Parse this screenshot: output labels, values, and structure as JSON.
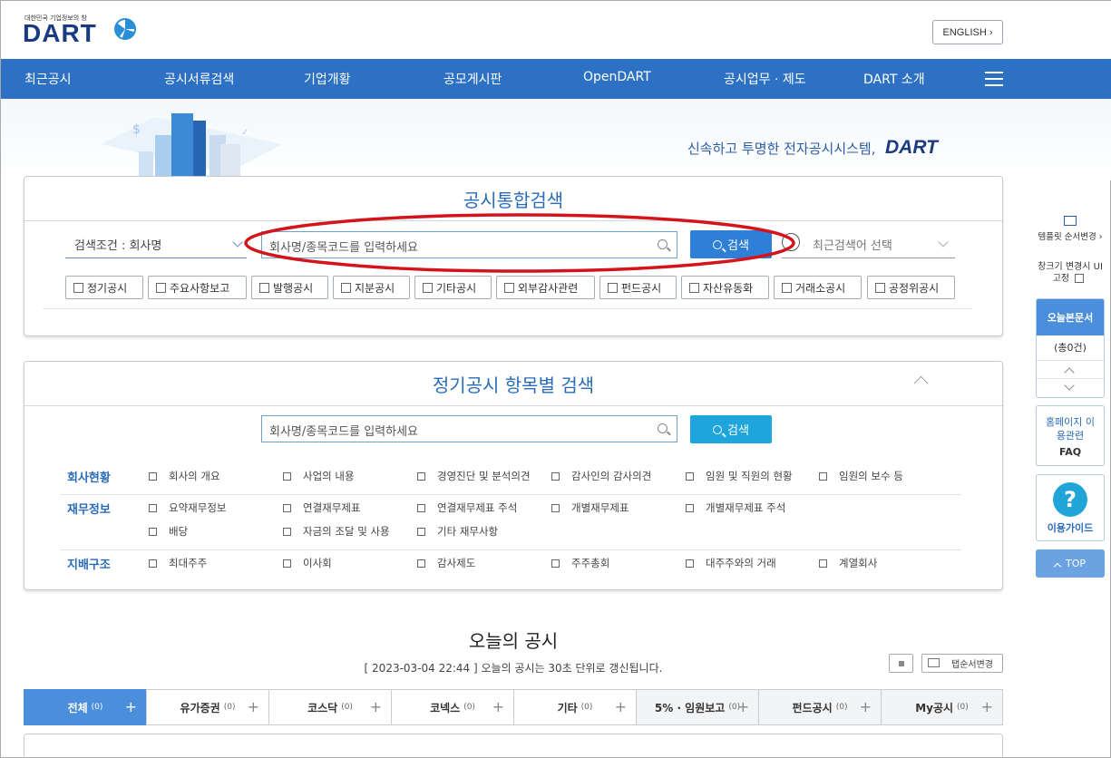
{
  "header": {
    "logo_tagline": "대한민국 기업정보의 창",
    "logo_text": "DART",
    "english_button": "ENGLISH ›"
  },
  "nav": {
    "items": [
      "최근공시",
      "공시서류검색",
      "기업개황",
      "공모게시판",
      "OpenDART",
      "공시업무 · 제도",
      "DART 소개"
    ]
  },
  "banner": {
    "tagline": "신속하고 투명한 전자공시시스템,",
    "tagline_brand": "DART"
  },
  "integrated_search": {
    "title": "공시통합검색",
    "condition_label": "검색조건 : 회사명",
    "search_placeholder": "회사명/종목코드를 입력하세요",
    "search_button": "검색",
    "recent_label": "최근검색어 선택",
    "checkboxes": [
      "정기공시",
      "주요사항보고",
      "발행공시",
      "지분공시",
      "기타공시",
      "외부감사관련",
      "펀드공시",
      "자산유동화",
      "거래소공시",
      "공정위공시"
    ]
  },
  "item_search": {
    "title": "정기공시 항목별 검색",
    "search_placeholder": "회사명/종목코드를 입력하세요",
    "search_button": "검색",
    "categories": [
      {
        "label": "회사현황",
        "items": [
          "회사의 개요",
          "사업의 내용",
          "경영진단 및 분석의견",
          "감사인의 감사의견",
          "임원 및 직원의 현황",
          "임원의 보수 등"
        ]
      },
      {
        "label": "재무정보",
        "items": [
          "요약재무정보",
          "연결재무제표",
          "연결재무제표 주석",
          "개별재무제표",
          "개별재무제표 주석",
          "배당",
          "자금의 조달 및 사용",
          "기타 재무사항"
        ]
      },
      {
        "label": "지배구조",
        "items": [
          "최대주주",
          "이사회",
          "감사제도",
          "주주총회",
          "대주주와의 거래",
          "계열회사"
        ]
      }
    ]
  },
  "today": {
    "title": "오늘의 공시",
    "update_note": "[ 2023-03-04 22:44 ] 오늘의 공시는 30초 단위로 갱신됩니다.",
    "tab_order_button": "탭순서변경",
    "tabs": [
      {
        "label": "전체",
        "count": "(0)"
      },
      {
        "label": "유가증권",
        "count": "(0)"
      },
      {
        "label": "코스닥",
        "count": "(0)"
      },
      {
        "label": "코넥스",
        "count": "(0)"
      },
      {
        "label": "기타",
        "count": "(0)"
      },
      {
        "label": "5% · 임원보고",
        "count": "(0)"
      },
      {
        "label": "펀드공시",
        "count": "(0)"
      },
      {
        "label": "My공시",
        "count": "(0)"
      }
    ]
  },
  "sidebar": {
    "template_label": "템플릿 순서변경 ›",
    "window_label": "창크기 변경시 UI고정",
    "today_docs": "오늘본문서",
    "today_count": "(총0건)",
    "homepage_guide": "홈페이지 이용관련",
    "faq": "FAQ",
    "usage_guide": "이용가이드",
    "top": "TOP"
  },
  "colors": {
    "nav_bg": "#2d71c4",
    "accent": "#2a6bb8",
    "button_blue": "#2d7fd8",
    "button_cyan": "#1ea6dc",
    "annotation_red": "#d4141b"
  }
}
